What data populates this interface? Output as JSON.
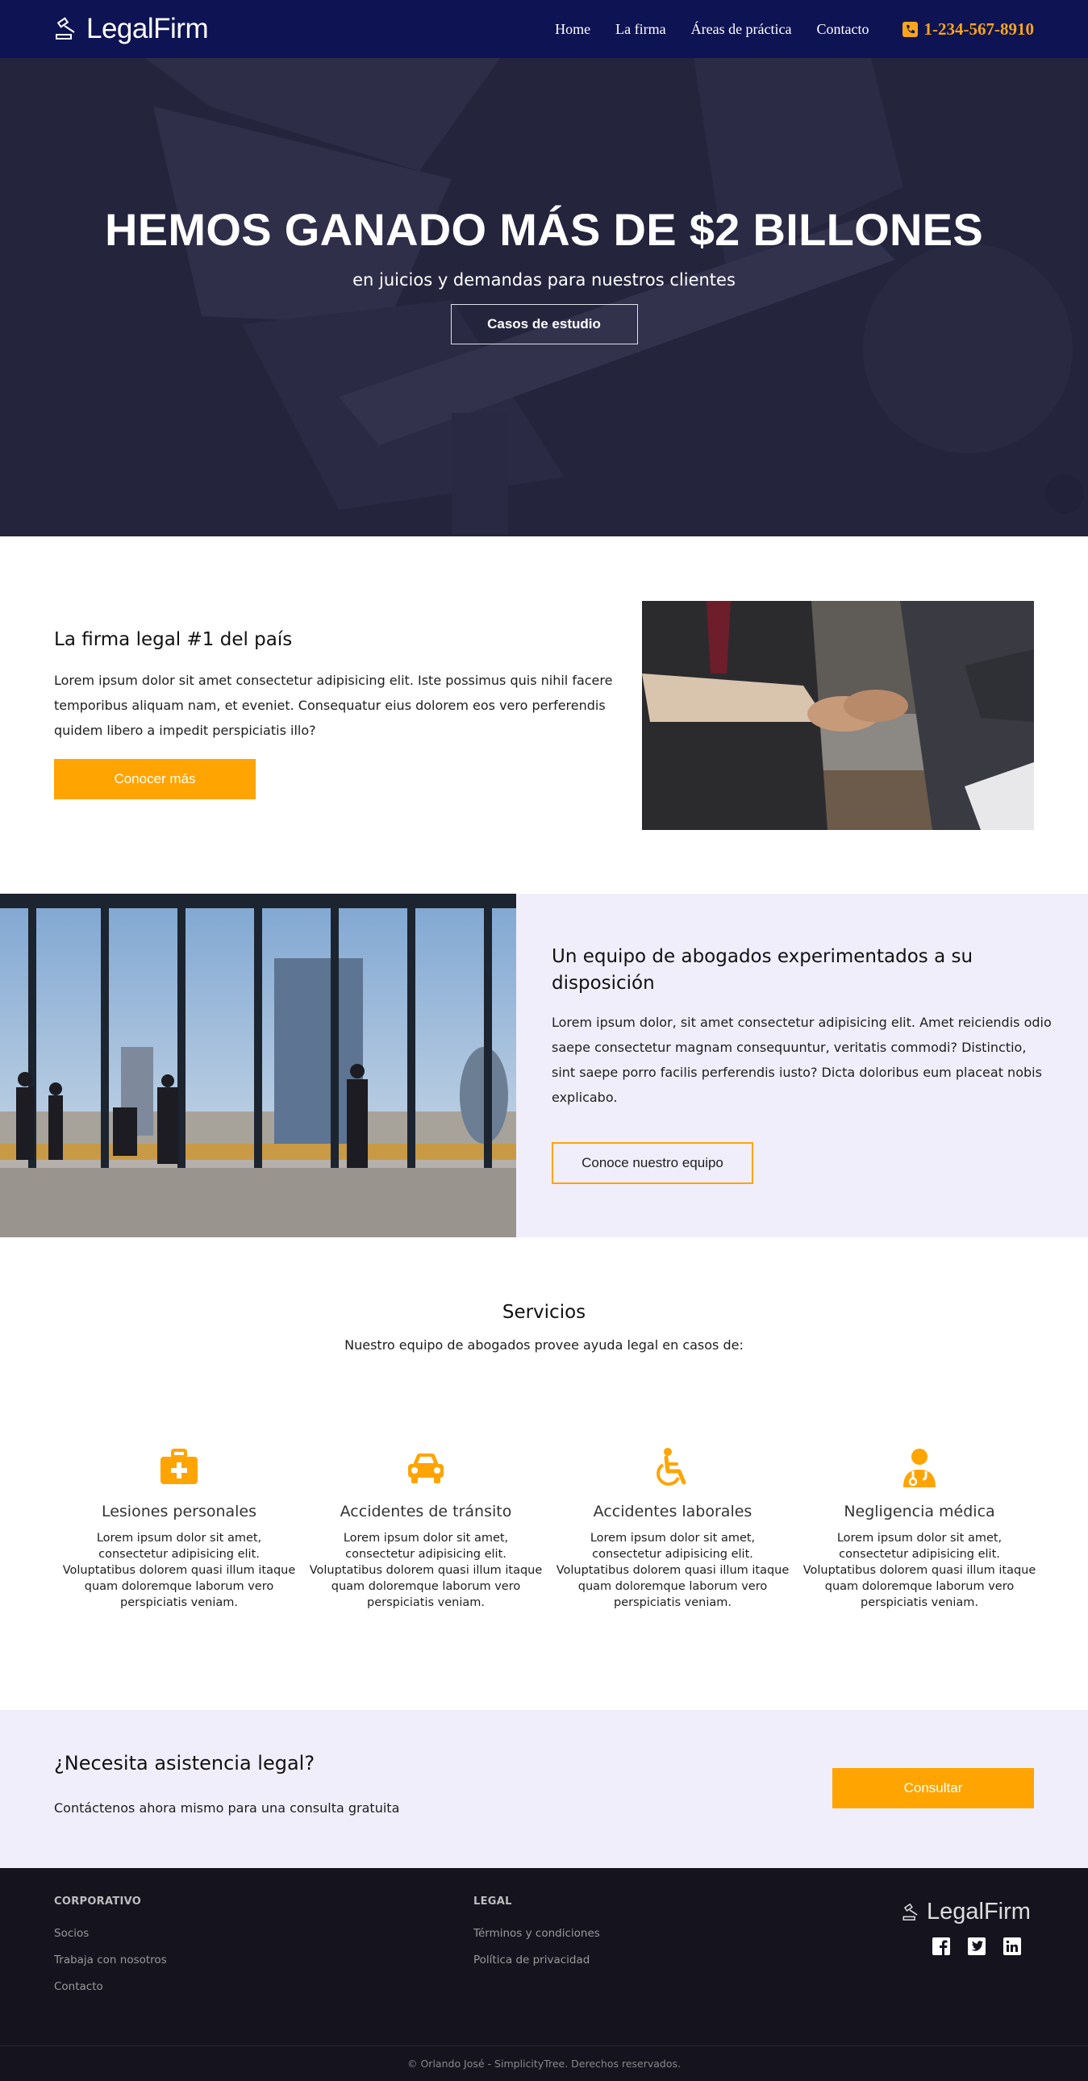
{
  "nav": {
    "brand": "LegalFirm",
    "links": [
      "Home",
      "La firma",
      "Áreas de práctica",
      "Contacto"
    ],
    "phone": "1-234-567-8910"
  },
  "hero": {
    "title": "HEMOS GANADO MÁS DE $2 BILLONES",
    "subtitle": "en juicios y demandas para nuestros clientes",
    "button": "Casos de estudio"
  },
  "firm": {
    "title": "La firma legal #1 del país",
    "text": "Lorem ipsum dolor sit amet consectetur adipisicing elit. Iste possimus quis nihil facere temporibus aliquam nam, et eveniet. Consequatur eius dolorem eos vero perferendis quidem libero a impedit perspiciatis illo?",
    "button": "Conocer más"
  },
  "team": {
    "title": "Un equipo de abogados experimentados a su disposición",
    "text": "Lorem ipsum dolor, sit amet consectetur adipisicing elit. Amet reiciendis odio saepe consectetur magnam consequuntur, veritatis commodi? Distinctio, sint saepe porro facilis perferendis iusto? Dicta doloribus eum placeat nobis explicabo.",
    "button": "Conoce nuestro equipo"
  },
  "services": {
    "title": "Servicios",
    "lead": "Nuestro equipo de abogados provee ayuda legal en casos de:",
    "items": [
      {
        "icon": "medkit-icon",
        "title": "Lesiones personales",
        "text": "Lorem ipsum dolor sit amet, consectetur adipisicing elit. Voluptatibus dolorem quasi illum itaque quam doloremque laborum vero perspiciatis veniam."
      },
      {
        "icon": "car-icon",
        "title": "Accidentes de tránsito",
        "text": "Lorem ipsum dolor sit amet, consectetur adipisicing elit. Voluptatibus dolorem quasi illum itaque quam doloremque laborum vero perspiciatis veniam."
      },
      {
        "icon": "wheelchair-icon",
        "title": "Accidentes laborales",
        "text": "Lorem ipsum dolor sit amet, consectetur adipisicing elit. Voluptatibus dolorem quasi illum itaque quam doloremque laborum vero perspiciatis veniam."
      },
      {
        "icon": "doctor-icon",
        "title": "Negligencia médica",
        "text": "Lorem ipsum dolor sit amet, consectetur adipisicing elit. Voluptatibus dolorem quasi illum itaque quam doloremque laborum vero perspiciatis veniam."
      }
    ]
  },
  "cta": {
    "title": "¿Necesita asistencia legal?",
    "text": "Contáctenos ahora mismo para una consulta gratuita",
    "button": "Consultar"
  },
  "footer": {
    "corporate_title": "CORPORATIVO",
    "corporate_links": [
      "Socios",
      "Trabaja con nosotros",
      "Contacto"
    ],
    "legal_title": "LEGAL",
    "legal_links": [
      "Términos y condiciones",
      "Política de privacidad"
    ],
    "brand": "LegalFirm",
    "social": [
      "facebook-icon",
      "twitter-icon",
      "linkedin-icon"
    ],
    "copyright": "© Orlando José - SimplicityTree. Derechos reservados."
  },
  "colors": {
    "nav_bg": "#0e1353",
    "accent": "#ffa400",
    "panel_bg": "#f1eefc",
    "footer_bg": "#15131e"
  }
}
